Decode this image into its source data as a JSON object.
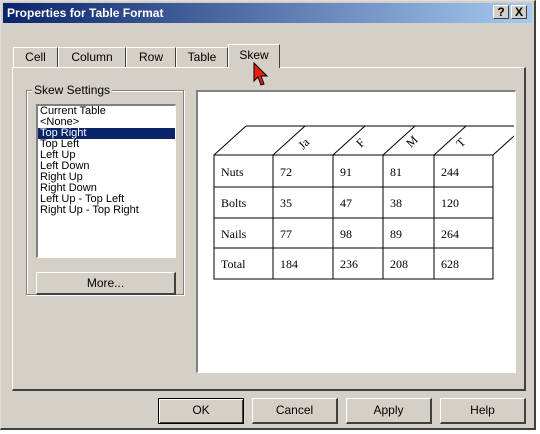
{
  "window": {
    "title": "Properties for Table Format",
    "help_btn": "?",
    "close_btn": "X"
  },
  "tabs": [
    {
      "label": "Cell"
    },
    {
      "label": "Column"
    },
    {
      "label": "Row"
    },
    {
      "label": "Table"
    },
    {
      "label": "Skew",
      "selected": true
    }
  ],
  "skew": {
    "group_label": "Skew Settings",
    "options": [
      "Current Table",
      "<None>",
      "Top Right",
      "Top Left",
      "Left Up",
      "Left Down",
      "Right Up",
      "Right Down",
      "Left Up - Top Left",
      "Right Up - Top Right"
    ],
    "selected_index": 2,
    "more_label": "More..."
  },
  "preview": {
    "headers": [
      "Ja",
      "F",
      "M",
      "T"
    ],
    "rows": [
      {
        "label": "Nuts",
        "values": [
          "72",
          "91",
          "81",
          "244"
        ]
      },
      {
        "label": "Bolts",
        "values": [
          "35",
          "47",
          "38",
          "120"
        ]
      },
      {
        "label": "Nails",
        "values": [
          "77",
          "98",
          "89",
          "264"
        ]
      },
      {
        "label": "Total",
        "values": [
          "184",
          "236",
          "208",
          "628"
        ]
      }
    ]
  },
  "buttons": {
    "ok": "OK",
    "cancel": "Cancel",
    "apply": "Apply",
    "help": "Help"
  },
  "colors": {
    "titlebar_start": "#0a246a",
    "titlebar_end": "#a6caf0",
    "selection": "#0a246a",
    "cursor": "#e8200c"
  }
}
